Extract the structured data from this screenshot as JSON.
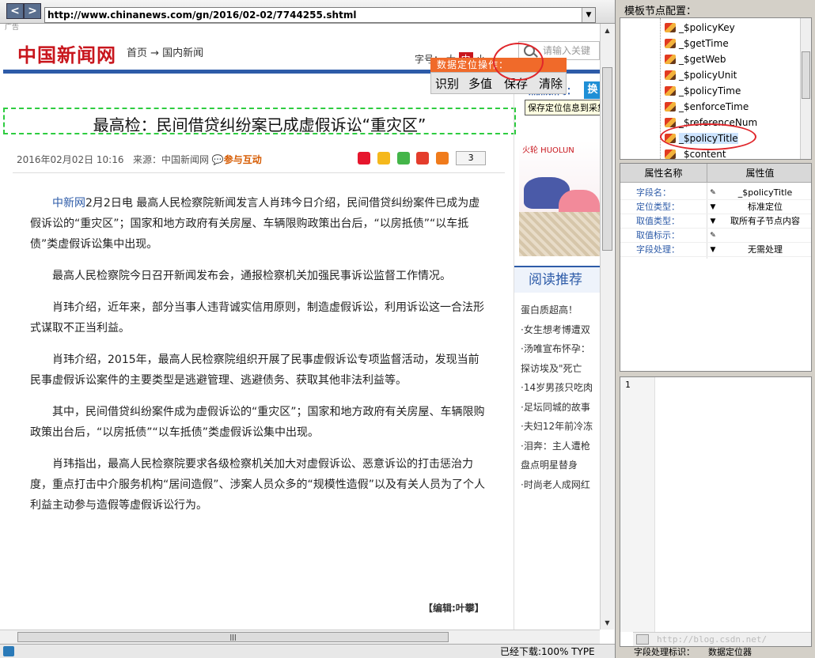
{
  "browser": {
    "url": "http://www.chinanews.com/gn/2016/02-02/7744255.shtml",
    "nav_back": "<",
    "nav_fwd": ">",
    "dropdown": "▼",
    "tiny_ad": "广告",
    "status": "已经下载:100% TYPE"
  },
  "site": {
    "logo": "中国新闻网",
    "breadcrumb": "首页 → 国内新闻",
    "font_label": "字号：",
    "font_sizes": [
      "大",
      "中",
      "小"
    ],
    "search_placeholder": "请输入关键词",
    "right_tag_text": "热点新闻：",
    "right_tag_btn": "换"
  },
  "popup": {
    "title": "数据定位操作：",
    "buttons": [
      "识别",
      "多值",
      "保存",
      "清除"
    ],
    "tooltip": "保存定位信息到采集配置"
  },
  "article": {
    "headline": "最高检：民间借贷纠纷案已成虚假诉讼“重灾区”",
    "date": "2016年02月02日 10:16",
    "source": "来源：中国新闻网",
    "interact": "参与互动",
    "share_count": "3",
    "lead_source": "中新网",
    "paragraphs": [
      "2月2日电 最高人民检察院新闻发言人肖玮今日介绍，民间借贷纠纷案件已成为虚假诉讼的“重灾区”；国家和地方政府有关房屋、车辆限购政策出台后，“以房抵债”“以车抵债”类虚假诉讼集中出现。",
      "最高人民检察院今日召开新闻发布会，通报检察机关加强民事诉讼监督工作情况。",
      "肖玮介绍，近年来，部分当事人违背诚实信用原则，制造虚假诉讼，利用诉讼这一合法形式谋取不正当利益。",
      "肖玮介绍，2015年，最高人民检察院组织开展了民事虚假诉讼专项监督活动，发现当前民事虚假诉讼案件的主要类型是逃避管理、逃避债务、获取其他非法利益等。",
      "其中，民间借贷纠纷案件成为虚假诉讼的“重灾区”；国家和地方政府有关房屋、车辆限购政策出台后，“以房抵债”“以车抵债”类虚假诉讼集中出现。",
      "肖玮指出，最高人民检察院要求各级检察机关加大对虚假诉讼、恶意诉讼的打击惩治力度，重点打击中介服务机构“居间造假”、涉案人员众多的“规模性造假”以及有关人员为了个人利益主动参与造假等虚假诉讼行为。"
    ],
    "editor": "【编辑:叶攀】"
  },
  "sidebar_news": {
    "ad_brand": "火轮 HUOLUN",
    "title": "阅读推荐",
    "items": [
      "蛋白质超高！",
      "·女生想考博遭双",
      "·汤唯宣布怀孕：",
      "探访埃及\"死亡",
      "·14岁男孩只吃肉",
      "·足坛同城的故事",
      "·夫妇12年前冷冻",
      "·泪奔：主人遭枪",
      "盘点明星替身",
      "·时尚老人成网红"
    ]
  },
  "config": {
    "title": "模板节点配置：",
    "tree_nodes": [
      "_$policyKey",
      "_$getTime",
      "_$getWeb",
      "_$policyUnit",
      "_$policyTime",
      "_$enforceTime",
      "_$referenceNum",
      "_$policyTitle",
      "_$content"
    ],
    "props_header": [
      "属性名称",
      "属性值"
    ],
    "props": [
      {
        "key": "字段名：",
        "mark": "✎",
        "value": "_$policyTitle"
      },
      {
        "key": "定位类型：",
        "mark": "▼",
        "value": "标准定位"
      },
      {
        "key": "取值类型：",
        "mark": "▼",
        "value": "取所有子节点内容"
      },
      {
        "key": "取值标示：",
        "mark": "✎",
        "value": ""
      },
      {
        "key": "字段处理：",
        "mark": "▼",
        "value": "无需处理"
      }
    ],
    "editor_line": "1",
    "watermark": "http://blog.csdn.net/",
    "tabs": [
      "字段处理标识：",
      "数据定位器"
    ]
  }
}
